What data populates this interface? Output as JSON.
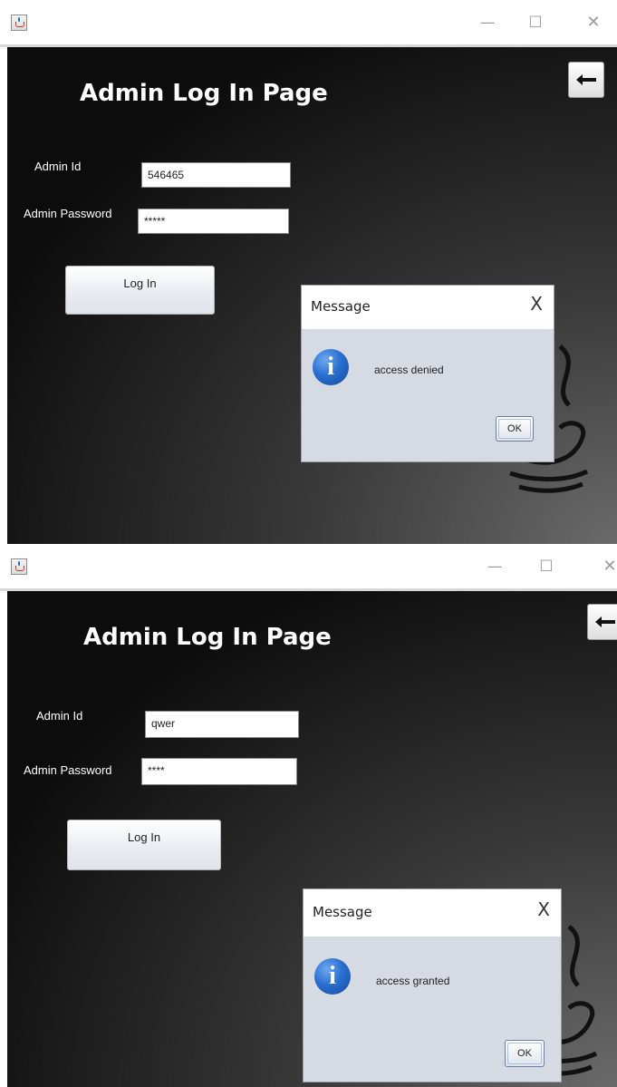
{
  "colors": {
    "content_dark": "#0c0c0c",
    "content_light": "#6a6a6a",
    "dialog_body": "#d6dae3",
    "info_blue": "#2a6fd0",
    "titlebar": "#ffffff"
  },
  "icons": {
    "app": "java-icon",
    "minimize": "minimize-icon",
    "maximize": "maximize-icon",
    "close": "close-icon",
    "back": "left-arrow-icon",
    "info": "info-icon",
    "logo": "java-logo"
  },
  "window_controls": {
    "minimize": "—",
    "maximize": "☐",
    "close": "✕"
  },
  "screens": [
    {
      "page_title": "Admin Log In Page",
      "admin_id_label": "Admin Id",
      "admin_id_value": "546465",
      "password_label": "Admin Password",
      "password_value": "*****",
      "login_label": "Log In",
      "dialog": {
        "title": "Message",
        "close": "X",
        "message": "access denied",
        "ok_label": "OK"
      }
    },
    {
      "page_title": "Admin Log In Page",
      "admin_id_label": "Admin Id",
      "admin_id_value": "qwer",
      "password_label": "Admin Password",
      "password_value": "****",
      "login_label": "Log In",
      "dialog": {
        "title": "Message",
        "close": "X",
        "message": "access granted",
        "ok_label": "OK"
      }
    }
  ]
}
